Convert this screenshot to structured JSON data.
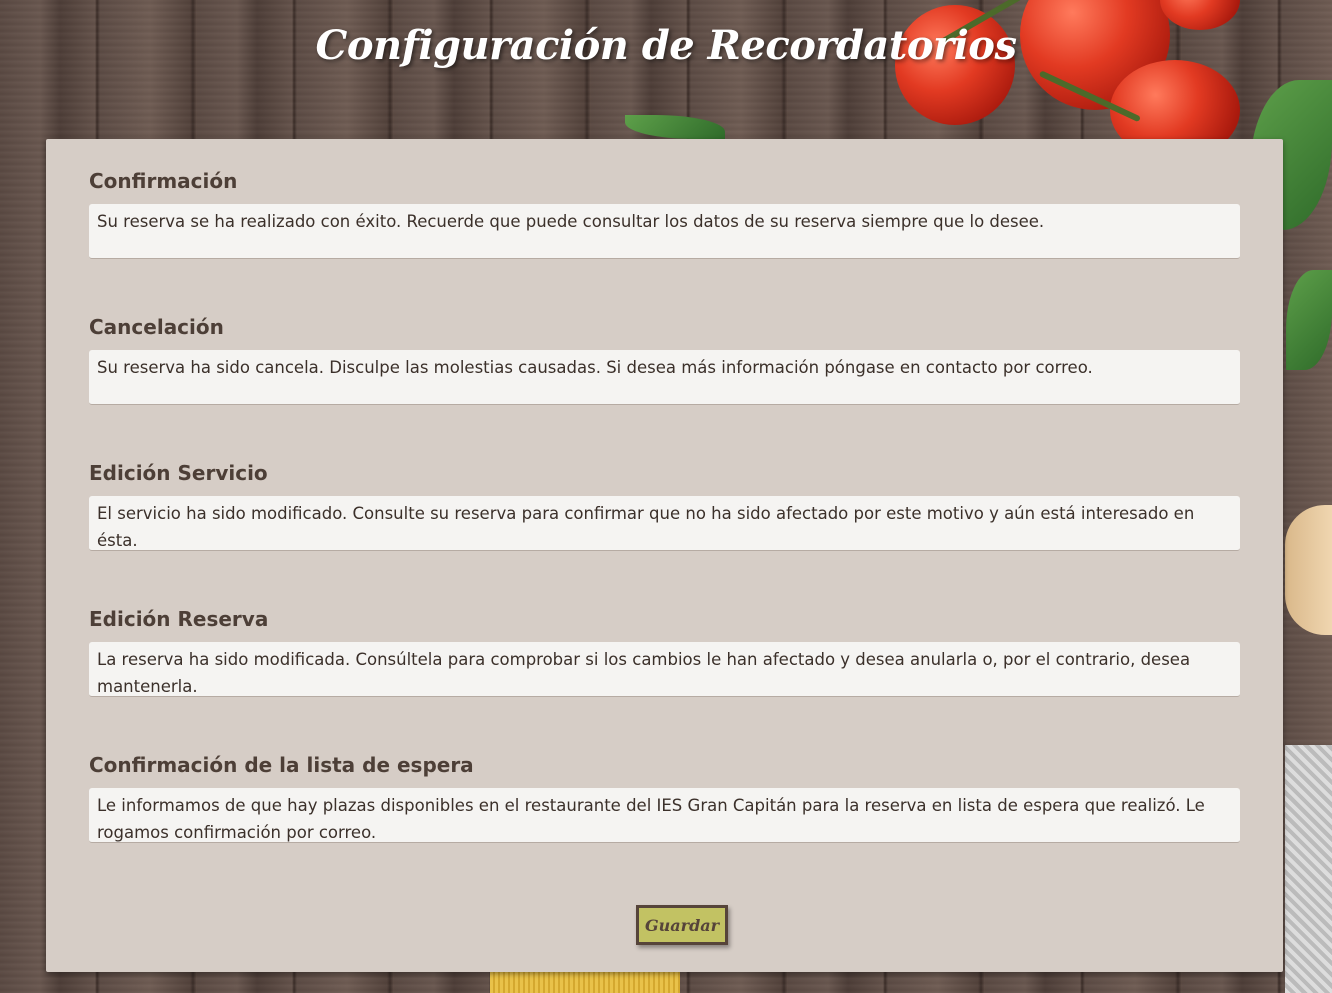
{
  "page": {
    "title": "Configuración de Recordatorios"
  },
  "sections": [
    {
      "label": "Confirmación",
      "value": "Su reserva se ha realizado con éxito. Recuerde que puede consultar los datos de su reserva siempre que lo desee."
    },
    {
      "label": "Cancelación",
      "value": "Su reserva ha sido cancela. Disculpe las molestias causadas. Si desea más información póngase en contacto por correo."
    },
    {
      "label": "Edición Servicio",
      "value": "El servicio ha sido modificado. Consulte su reserva para confirmar que no ha sido afectado por este motivo y aún está interesado en ésta."
    },
    {
      "label": "Edición Reserva",
      "value": "La reserva ha sido modificada. Consúltela para comprobar si los cambios le han afectado y desea anularla o, por el contrario, desea mantenerla."
    },
    {
      "label": "Confirmación de la lista de espera",
      "value": "Le informamos de que hay plazas disponibles en el restaurante del IES Gran Capitán para la reserva en lista de espera que realizó. Le rogamos confirmación por correo."
    }
  ],
  "actions": {
    "save_label": "Guardar"
  },
  "colors": {
    "panel_bg": "#d6cdc6",
    "label_text": "#4d3f37",
    "button_bg": "#c2c263",
    "button_border": "#56443a"
  }
}
